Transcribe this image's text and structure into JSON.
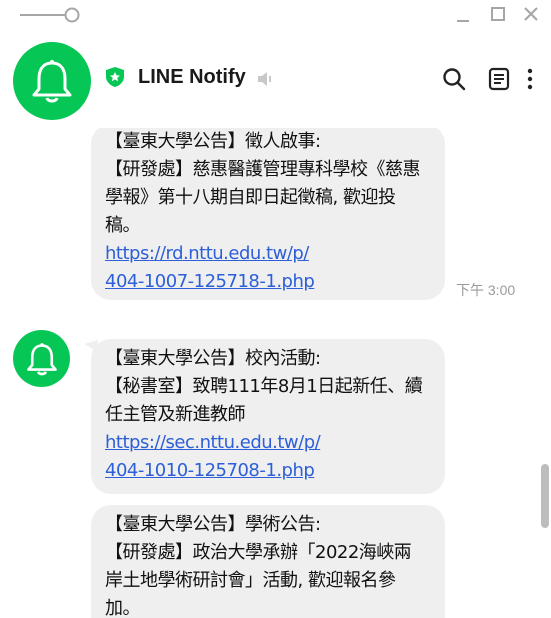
{
  "window": {
    "minimize": "—",
    "maximize": "☐",
    "close": "✕"
  },
  "header": {
    "title": "LINE Notify"
  },
  "messages": [
    {
      "lines": [
        "【臺東大學公告】徵人啟事:",
        "【研發處】慈惠醫護管理專科學校《慈惠",
        "學報》第十八期自即日起徵稿, 歡迎投",
        "稿。"
      ],
      "link": [
        "https://rd.nttu.edu.tw/p/",
        "404-1007-125718-1.php"
      ],
      "time": "下午 3:00"
    },
    {
      "lines": [
        "【臺東大學公告】校內活動:",
        "【秘書室】致聘111年8月1日起新任、續",
        "任主管及新進教師"
      ],
      "link": [
        "https://sec.nttu.edu.tw/p/",
        "404-1010-125708-1.php"
      ]
    },
    {
      "lines": [
        "【臺東大學公告】學術公告:",
        "【研發處】政治大學承辦「2022海峽兩",
        "岸土地學術研討會」活動, 歡迎報名參",
        "加。"
      ]
    }
  ]
}
